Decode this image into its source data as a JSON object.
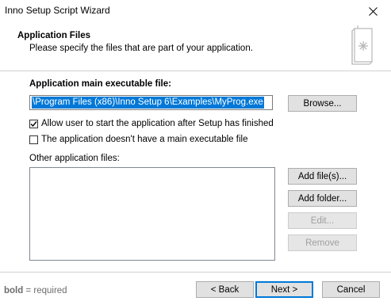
{
  "window": {
    "title": "Inno Setup Script Wizard"
  },
  "header": {
    "title": "Application Files",
    "description": "Please specify the files that are part of your application.",
    "icon": "wizard-page-icon"
  },
  "main_exe": {
    "label": "Application main executable file:",
    "value": "\\Program Files (x86)\\Inno Setup 6\\Examples\\MyProg.exe",
    "browse_label": "Browse..."
  },
  "options": {
    "allow_start": {
      "label": "Allow user to start the application after Setup has finished",
      "checked": true
    },
    "no_main_exe": {
      "label": "The application doesn't have a main executable file",
      "checked": false
    }
  },
  "other_files": {
    "label": "Other application files:",
    "items": [],
    "add_files_label": "Add file(s)...",
    "add_folder_label": "Add folder...",
    "edit_label": "Edit...",
    "remove_label": "Remove"
  },
  "footer": {
    "hint_bold": "bold",
    "hint_rest": " = required",
    "back_label": "< Back",
    "next_label": "Next >",
    "cancel_label": "Cancel"
  },
  "colors": {
    "selection": "#0078d7",
    "default_button_border": "#0078d7"
  }
}
